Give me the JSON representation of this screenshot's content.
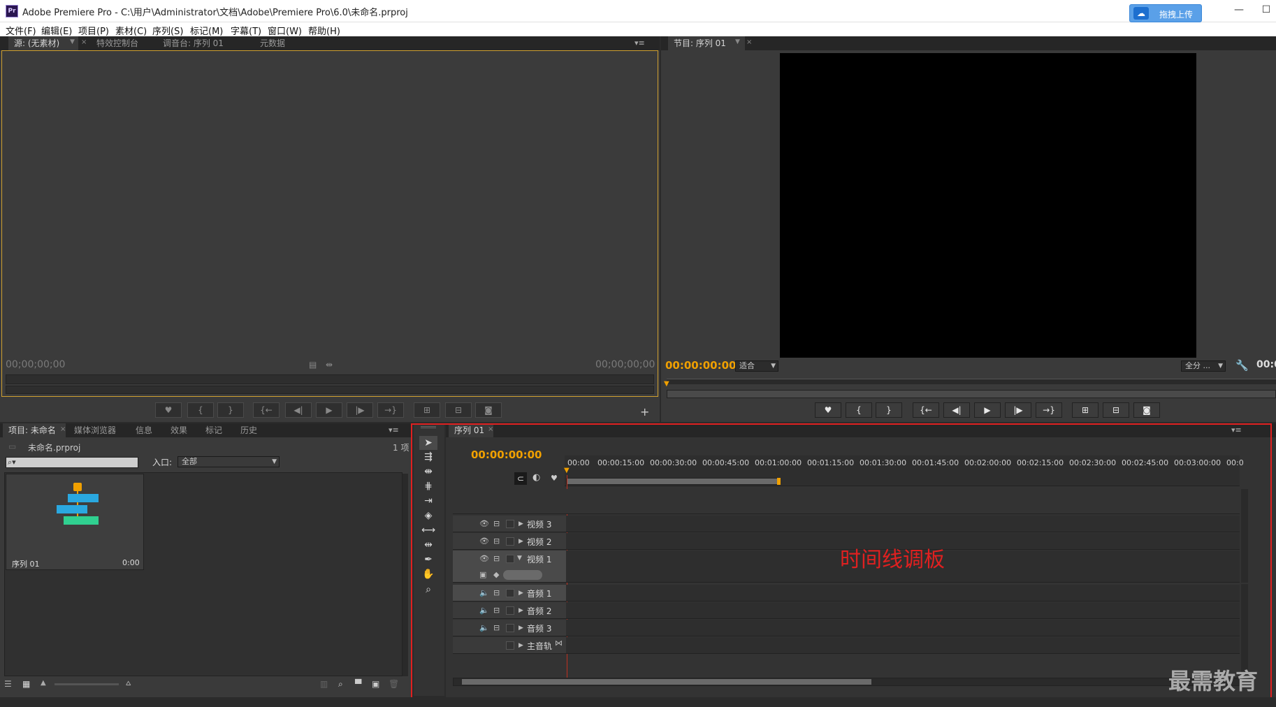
{
  "window": {
    "app_icon": "Pr",
    "title": "Adobe Premiere Pro - C:\\用户\\Administrator\\文档\\Adobe\\Premiere Pro\\6.0\\未命名.prproj",
    "upload_label": "拖拽上传",
    "minimize_glyph": "—",
    "maximize_glyph": "☐"
  },
  "menu": [
    "文件(F)",
    "编辑(E)",
    "项目(P)",
    "素材(C)",
    "序列(S)",
    "标记(M)",
    "字幕(T)",
    "窗口(W)",
    "帮助(H)"
  ],
  "source_panel": {
    "tabs": [
      "源: (无素材)",
      "特效控制台",
      "调音台: 序列 01",
      "元数据"
    ],
    "timecode_left": "00;00;00;00",
    "timecode_right": "00;00;00;00"
  },
  "program_panel": {
    "tab": "节目: 序列 01",
    "timecode": "00:00:00:00",
    "fit_label": "适合",
    "resolution_label": "全分 ...",
    "timecode_right": "00:0"
  },
  "project_panel": {
    "tabs": [
      "项目: 未命名",
      "媒体浏览器",
      "信息",
      "效果",
      "标记",
      "历史"
    ],
    "project_file": "未命名.prproj",
    "item_count": "1 项",
    "search_placeholder": "",
    "in_label": "入口:",
    "in_value": "全部",
    "bin_item_name": "序列 01",
    "bin_item_duration": "0:00"
  },
  "timeline": {
    "tab": "序列 01",
    "timecode": "00:00:00:00",
    "ruler": [
      "00:00",
      "00:00:15:00",
      "00:00:30:00",
      "00:00:45:00",
      "00:01:00:00",
      "00:01:15:00",
      "00:01:30:00",
      "00:01:45:00",
      "00:02:00:00",
      "00:02:15:00",
      "00:02:30:00",
      "00:02:45:00",
      "00:03:00:00",
      "00:0"
    ],
    "video_tracks": [
      "视频 3",
      "视频 2",
      "视频 1"
    ],
    "audio_tracks": [
      "音频 1",
      "音频 2",
      "音频 3"
    ],
    "master_track": "主音轨",
    "annotation": "时间线调板"
  },
  "watermark": "最需教育",
  "accent_colors": {
    "timecode": "#f0a000",
    "annotation": "#e02020",
    "playhead": "#c03020"
  }
}
